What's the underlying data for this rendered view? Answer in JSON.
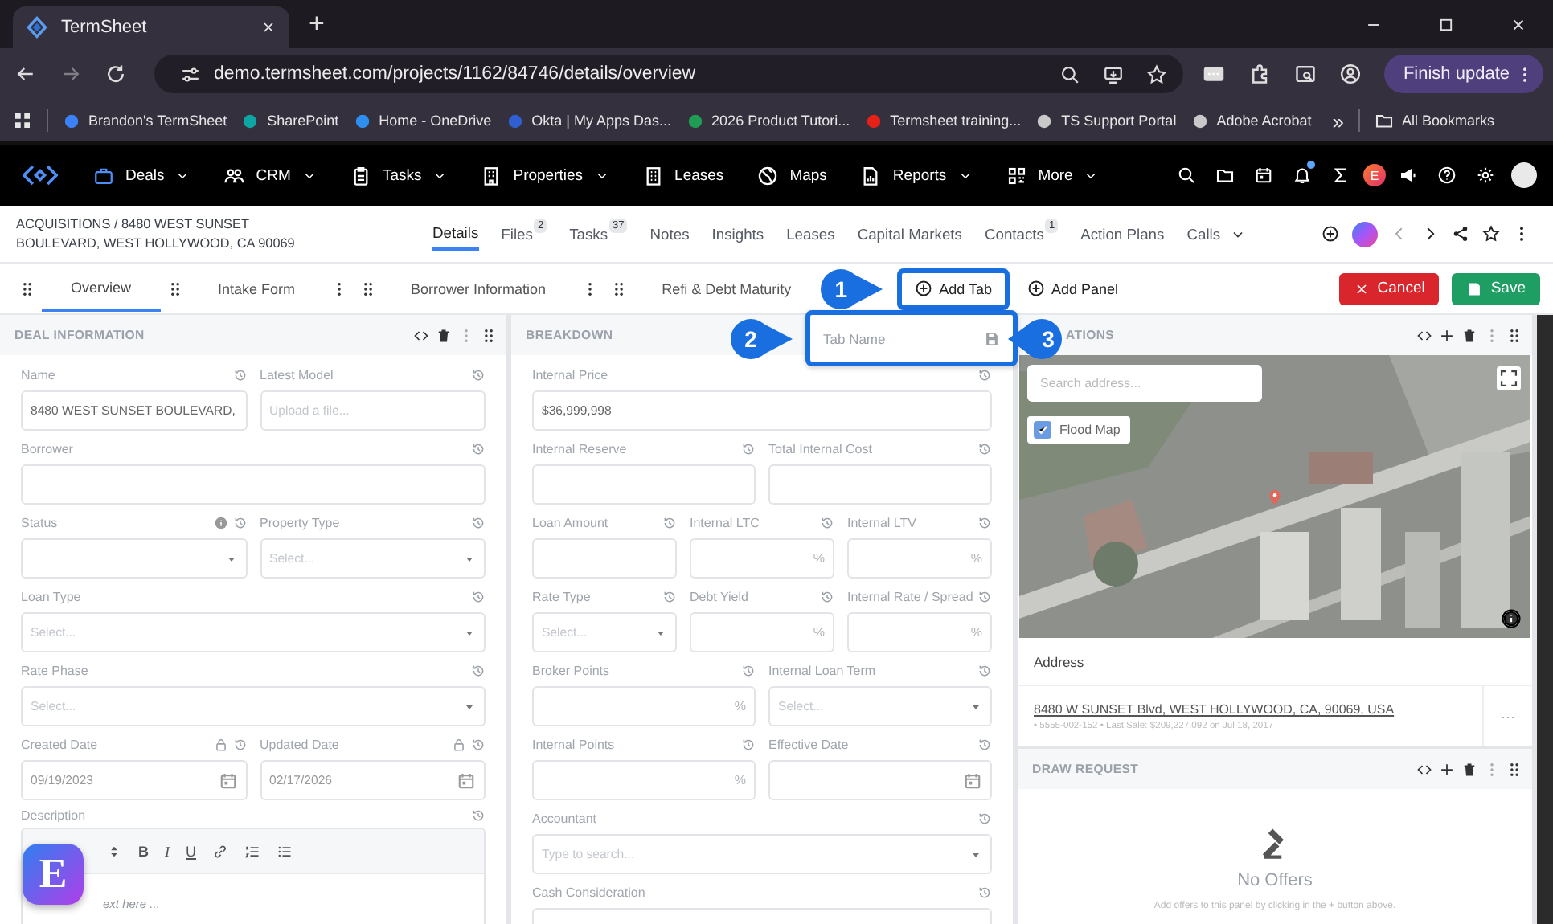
{
  "browser": {
    "tab": {
      "title": "TermSheet"
    },
    "new_tab": "+",
    "url": "demo.termsheet.com/projects/1162/84746/details/overview",
    "update_button": "Finish update",
    "bookmarks": [
      {
        "label": "Brandon's TermSheet"
      },
      {
        "label": "SharePoint"
      },
      {
        "label": "Home - OneDrive"
      },
      {
        "label": "Okta | My Apps Das..."
      },
      {
        "label": "2026 Product Tutori..."
      },
      {
        "label": "Termsheet training..."
      },
      {
        "label": "TS Support Portal"
      },
      {
        "label": "Adobe Acrobat"
      }
    ],
    "more_bookmarks": "»",
    "all_bookmarks": "All Bookmarks"
  },
  "nav": {
    "items": [
      {
        "label": "Deals",
        "dropdown": true
      },
      {
        "label": "CRM",
        "dropdown": true
      },
      {
        "label": "Tasks",
        "dropdown": true
      },
      {
        "label": "Properties",
        "dropdown": true
      },
      {
        "label": "Leases",
        "dropdown": false
      },
      {
        "label": "Maps",
        "dropdown": false
      },
      {
        "label": "Reports",
        "dropdown": true
      },
      {
        "label": "More",
        "dropdown": true
      }
    ],
    "notification": true,
    "avatar": "E"
  },
  "header": {
    "breadcrumb": "ACQUISITIONS / 8480 WEST SUNSET BOULEVARD, WEST HOLLYWOOD, CA 90069",
    "tabs": [
      {
        "label": "Details",
        "selected": true
      },
      {
        "label": "Files",
        "badge": "2",
        "selected": false
      },
      {
        "label": "Tasks",
        "badge": "37",
        "selected": false
      },
      {
        "label": "Notes",
        "selected": false
      },
      {
        "label": "Insights",
        "selected": false
      },
      {
        "label": "Leases",
        "selected": false
      },
      {
        "label": "Capital Markets",
        "selected": false
      },
      {
        "label": "Contacts",
        "badge": "1",
        "selected": false
      },
      {
        "label": "Action Plans",
        "selected": false
      },
      {
        "label": "Calls",
        "dropdown": true,
        "selected": false
      }
    ]
  },
  "layout_bar": {
    "tabs": [
      {
        "label": "Overview",
        "selected": true,
        "menu": false
      },
      {
        "label": "Intake Form",
        "selected": false,
        "menu": true
      },
      {
        "label": "Borrower Information",
        "selected": false,
        "menu": true
      },
      {
        "label": "Refi & Debt Maturity",
        "selected": false,
        "menu": false
      }
    ],
    "add_tab": {
      "label": "Add Tab",
      "highlighted": true
    },
    "add_panel": "Add Panel",
    "cancel": "Cancel",
    "save": "Save",
    "tab_name_field": {
      "placeholder": "Tab Name",
      "highlighted": true
    }
  },
  "callouts": [
    "1",
    "2",
    "3"
  ],
  "deal_information": {
    "title": "DEAL INFORMATION",
    "rows": [
      [
        {
          "label": "Name",
          "kind": "input",
          "value": "8480 WEST SUNSET BOULEVARD,"
        },
        {
          "label": "Latest Model",
          "kind": "input",
          "placeholder": "Upload a file..."
        }
      ],
      [
        {
          "label": "Borrower",
          "kind": "input"
        }
      ],
      [
        {
          "label": "Status",
          "kind": "select",
          "info": true
        },
        {
          "label": "Property Type",
          "kind": "select",
          "placeholder": "Select..."
        }
      ],
      [
        {
          "label": "Loan Type",
          "kind": "select",
          "placeholder": "Select..."
        }
      ],
      [
        {
          "label": "Rate Phase",
          "kind": "select",
          "placeholder": "Select..."
        }
      ],
      [
        {
          "label": "Created Date",
          "kind": "date",
          "value": "09/19/2023",
          "locked": true
        },
        {
          "label": "Updated Date",
          "kind": "date",
          "value": "02/17/2026",
          "locked": true
        }
      ],
      [
        {
          "label": "Description",
          "kind": "editor",
          "tools": [
            "B",
            "I",
            "U"
          ],
          "placeholder": "ext here ..."
        }
      ]
    ]
  },
  "breakdown": {
    "title": "BREAKDOWN",
    "rows": [
      [
        {
          "label": "Internal Price",
          "kind": "input",
          "value": "$36,999,998"
        }
      ],
      [
        {
          "label": "Internal Reserve",
          "kind": "input"
        },
        {
          "label": "Total Internal Cost",
          "kind": "input"
        }
      ],
      [
        {
          "label": "Loan Amount",
          "kind": "input"
        },
        {
          "label": "Internal LTC",
          "kind": "input",
          "suffix": "%"
        },
        {
          "label": "Internal LTV",
          "kind": "input",
          "suffix": "%"
        }
      ],
      [
        {
          "label": "Rate Type",
          "kind": "select",
          "placeholder": "Select..."
        },
        {
          "label": "Debt Yield",
          "kind": "input",
          "suffix": "%"
        },
        {
          "label": "Internal Rate / Spread",
          "kind": "input",
          "suffix": "%"
        }
      ],
      [
        {
          "label": "Broker Points",
          "kind": "input",
          "suffix": "%"
        },
        {
          "label": "Internal Loan Term",
          "kind": "select",
          "placeholder": "Select..."
        }
      ],
      [
        {
          "label": "Internal Points",
          "kind": "input",
          "suffix": "%"
        },
        {
          "label": "Effective Date",
          "kind": "date"
        }
      ],
      [
        {
          "label": "Accountant",
          "kind": "select",
          "placeholder": "Type to search..."
        }
      ],
      [
        {
          "label": "Cash Consideration",
          "kind": "input"
        }
      ]
    ]
  },
  "locations": {
    "title": "ATIONS",
    "add": true,
    "map": {
      "search_placeholder": "Search address...",
      "flood_map": {
        "label": "Flood Map",
        "checked": true
      }
    },
    "address_header": "Address",
    "address": "8480 W SUNSET Blvd, WEST HOLLYWOOD, CA, 90069, USA",
    "address_detail": "• 5555-002-152 • Last Sale: $209,227,092 on Jul 18, 2017",
    "row_menu": "···"
  },
  "draw_request": {
    "title": "DRAW REQUEST",
    "add": true,
    "empty_title": "No Offers",
    "empty_text": "Add offers to this panel by clicking in the + button above."
  },
  "launcher": "E"
}
